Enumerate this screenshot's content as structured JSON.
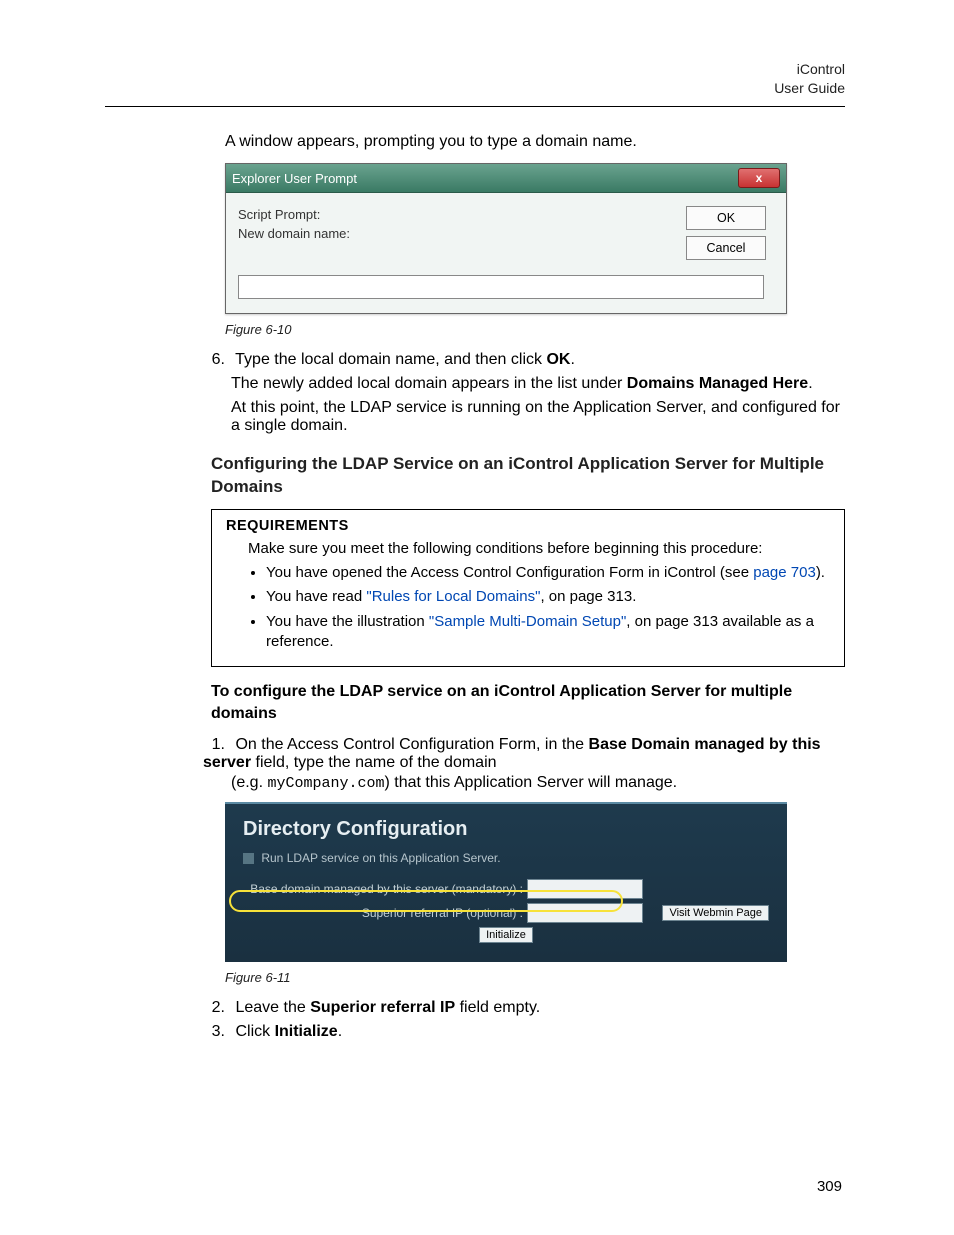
{
  "header": {
    "product": "iControl",
    "doc": "User Guide"
  },
  "intro": "A window appears, prompting you to type a domain name.",
  "dialog1": {
    "title": "Explorer User Prompt",
    "close": "x",
    "lines": {
      "l1": "Script Prompt:",
      "l2": "New domain name:"
    },
    "ok": "OK",
    "cancel": "Cancel",
    "input_value": ""
  },
  "fig1_caption": "Figure 6-10",
  "step6": {
    "num": "6.",
    "text_a": "Type the local domain name, and then click ",
    "text_b": "OK",
    "text_c": ".",
    "p2_a": "The newly added local domain appears in the list under ",
    "p2_b": "Domains Managed Here",
    "p2_c": ".",
    "p3": "At this point, the LDAP service is running on the Application Server, and configured for a single domain."
  },
  "subheading": "Configuring the LDAP Service on an iControl Application Server for Multiple Domains",
  "req": {
    "title": "REQUIREMENTS",
    "lead": "Make sure you meet the following conditions before beginning this procedure:",
    "b1_a": "You have opened the Access Control Configuration Form in iControl (see ",
    "b1_link": "page 703",
    "b1_b": ").",
    "b2_a": "You have read ",
    "b2_link": "\"Rules for Local Domains\"",
    "b2_b": ", on page 313.",
    "b3_a": "You have the illustration ",
    "b3_link": "\"Sample Multi-Domain Setup\"",
    "b3_b": ", on page 313 available as a reference."
  },
  "tolead": "To configure the LDAP service on an iControl Application Server for multiple domains",
  "s1": {
    "num": "1.",
    "a": "On the Access Control Configuration Form, in the ",
    "b": "Base Domain managed by this server",
    "c": " field, type the name of the domain",
    "d": "(e.g. ",
    "d2": "myCompany.com",
    "e": ") that this Application Server will manage."
  },
  "panel": {
    "title": "Directory Configuration",
    "chk_label": "Run LDAP service on this Application Server.",
    "f1_label": "Base domain managed by this server (mandatory) :",
    "f2_label": "Superior referral IP (optional) :",
    "f1_value": "",
    "f2_value": "",
    "visit": "Visit Webmin Page",
    "init": "Initialize"
  },
  "fig2_caption": "Figure 6-11",
  "s2": {
    "num": "2.",
    "a": "Leave the ",
    "b": "Superior referral IP",
    "c": " field empty."
  },
  "s3": {
    "num": "3.",
    "a": "Click ",
    "b": "Initialize",
    "c": "."
  },
  "page_number": "309"
}
